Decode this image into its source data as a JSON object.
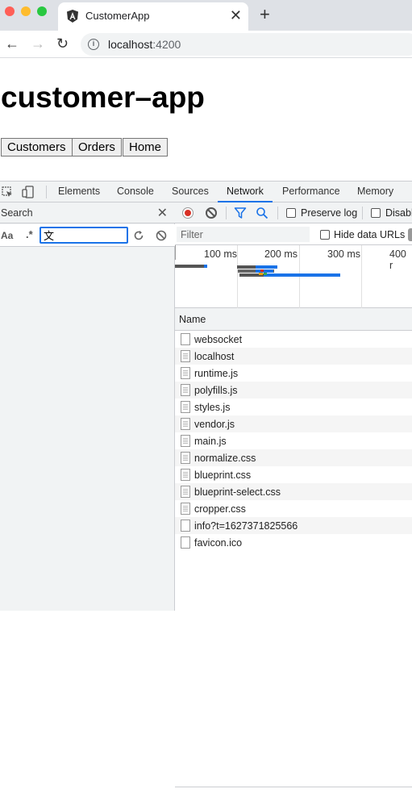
{
  "browser": {
    "tab_title": "CustomerApp",
    "url_host": "localhost",
    "url_port": ":4200"
  },
  "page": {
    "title": "customer–app",
    "buttons": [
      "Customers",
      "Orders",
      "Home"
    ]
  },
  "devtools": {
    "tabs": [
      "Elements",
      "Console",
      "Sources",
      "Network",
      "Performance",
      "Memory"
    ],
    "active_tab": "Network",
    "search": {
      "title": "Search",
      "case_label": "Aa",
      "regex_label": ".*",
      "query": "文"
    },
    "network": {
      "preserve_log": "Preserve log",
      "disable_cache": "Disabl",
      "filter_placeholder": "Filter",
      "hide_data_urls": "Hide data URLs",
      "time_labels": [
        "100 ms",
        "200 ms",
        "300 ms",
        "400 r"
      ],
      "column_name": "Name",
      "requests": [
        {
          "name": "websocket",
          "icon": "blank"
        },
        {
          "name": "localhost",
          "icon": "lined"
        },
        {
          "name": "runtime.js",
          "icon": "lined"
        },
        {
          "name": "polyfills.js",
          "icon": "lined"
        },
        {
          "name": "styles.js",
          "icon": "lined"
        },
        {
          "name": "vendor.js",
          "icon": "lined"
        },
        {
          "name": "main.js",
          "icon": "lined"
        },
        {
          "name": "normalize.css",
          "icon": "lined"
        },
        {
          "name": "blueprint.css",
          "icon": "lined"
        },
        {
          "name": "blueprint-select.css",
          "icon": "lined"
        },
        {
          "name": "cropper.css",
          "icon": "lined"
        },
        {
          "name": "info?t=1627371825566",
          "icon": "blank"
        },
        {
          "name": "favicon.ico",
          "icon": "blank"
        }
      ]
    }
  },
  "colors": {
    "accent": "#1a73e8",
    "record": "#d93025",
    "tabbar": "#dee1e6"
  }
}
